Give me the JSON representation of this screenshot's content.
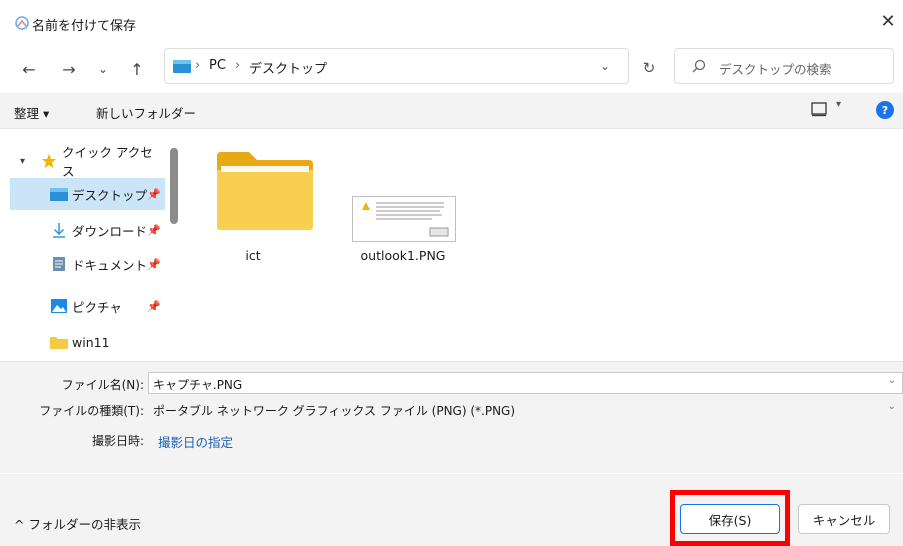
{
  "window": {
    "title": "名前を付けて保存",
    "close_glyph": "✕"
  },
  "nav": {
    "back_glyph": "←",
    "forward_glyph": "→",
    "recent_glyph": "⌄",
    "up_glyph": "↑",
    "breadcrumb": [
      "PC",
      "デスクトップ"
    ],
    "separator": "›",
    "refresh_glyph": "↻",
    "search_placeholder": "デスクトップの検索"
  },
  "commandbar": {
    "organize_label": "整理 ▾",
    "new_folder_label": "新しいフォルダー",
    "help_label": "?"
  },
  "sidebar": {
    "items": [
      {
        "label": "クイック アクセス",
        "icon": "star-icon"
      },
      {
        "label": "デスクトップ",
        "icon": "desktop-icon",
        "pinned": true,
        "selected": true
      },
      {
        "label": "ダウンロード",
        "icon": "download-icon",
        "pinned": true
      },
      {
        "label": "ドキュメント",
        "icon": "document-icon",
        "pinned": true
      },
      {
        "label": "ピクチャ",
        "icon": "pictures-icon",
        "pinned": true
      },
      {
        "label": "win11",
        "icon": "folder-icon"
      }
    ]
  },
  "files": [
    {
      "name": "ict",
      "type": "folder"
    },
    {
      "name": "outlook1.PNG",
      "type": "image"
    }
  ],
  "form": {
    "filename_label": "ファイル名(N):",
    "filename_value": "キャプチャ.PNG",
    "filetype_label": "ファイルの種類(T):",
    "filetype_value": "ポータブル ネットワーク グラフィックス ファイル (PNG) (*.PNG)",
    "date_label": "撮影日時:",
    "date_link": "撮影日の指定"
  },
  "footer": {
    "hide_folders_label": "^ フォルダーの非表示",
    "save_label": "保存(S)",
    "cancel_label": "キャンセル"
  },
  "colors": {
    "accent": "#1a73e8",
    "selection": "#cce4f7",
    "highlight": "#ff0000",
    "folder": "#f6c945"
  }
}
